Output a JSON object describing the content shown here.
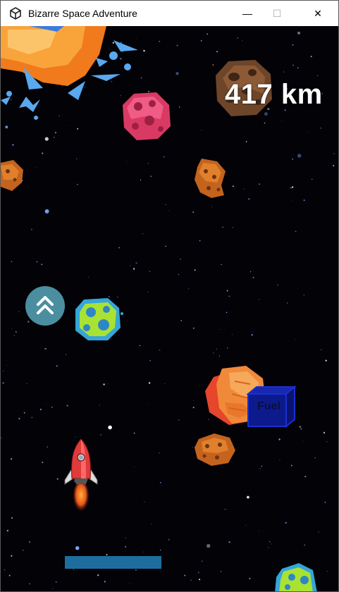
{
  "window": {
    "title": "Bizarre Space Adventure",
    "controls": {
      "minimize": "—",
      "maximize": "☐",
      "close": "✕"
    }
  },
  "hud": {
    "distance": "417 km",
    "fuel_level": 0.35
  },
  "pickups": {
    "fuel_label": "Fuel"
  },
  "colors": {
    "fuel_bar": "#1d6e9f",
    "boost_button": "#4b8ea0",
    "background": "#020207"
  },
  "icons": [
    "unity-logo-icon",
    "boost-up-icon",
    "rocket-player",
    "fuel-box-icon"
  ]
}
